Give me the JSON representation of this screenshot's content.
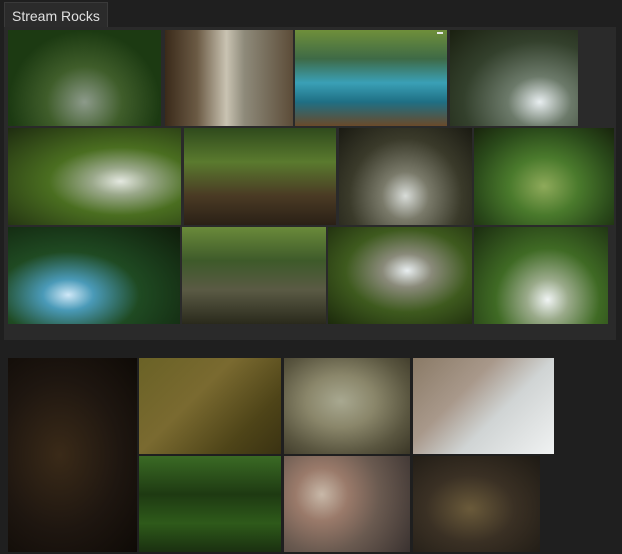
{
  "board": {
    "title": "Stream Rocks"
  },
  "gallery": {
    "section1_count": 12,
    "section2_count": 7
  }
}
